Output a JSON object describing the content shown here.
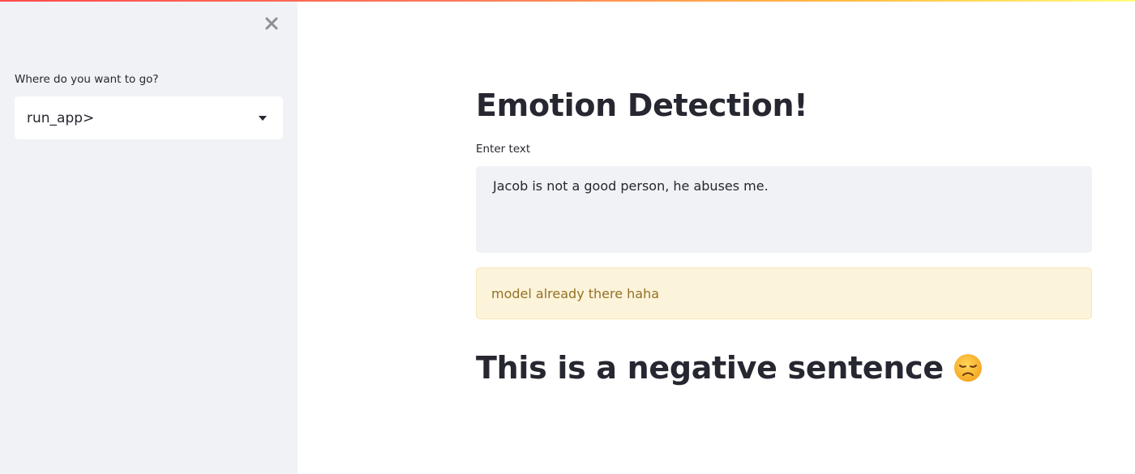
{
  "sidebar": {
    "close_icon": "close-icon",
    "nav_label": "Where do you want to go?",
    "select": {
      "value": "run_app>",
      "arrow_icon": "caret-down-icon"
    }
  },
  "main": {
    "title": "Emotion Detection!",
    "input_label": "Enter text",
    "input_value": "Jacob is not a good person, he abuses me.",
    "alert_text": "model already there haha",
    "result_text": "This is a negative sentence",
    "result_emoji_icon": "disappointed-face-icon"
  },
  "colors": {
    "sidebar_bg": "#f0f2f6",
    "text": "#262730",
    "alert_bg": "#fcf3db",
    "alert_text": "#927226"
  }
}
